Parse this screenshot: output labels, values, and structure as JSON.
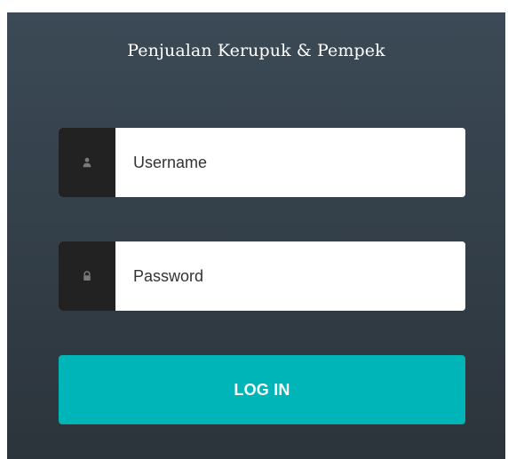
{
  "form": {
    "title": "Penjualan Kerupuk & Pempek",
    "username": {
      "placeholder": "Username",
      "value": "",
      "icon": "user-icon"
    },
    "password": {
      "placeholder": "Password",
      "value": "",
      "icon": "lock-icon"
    },
    "login_label": "LOG IN"
  },
  "colors": {
    "panel_top": "#3b4a56",
    "panel_bottom": "#2c343b",
    "icon_box": "#222222",
    "button": "#00b5b8"
  }
}
